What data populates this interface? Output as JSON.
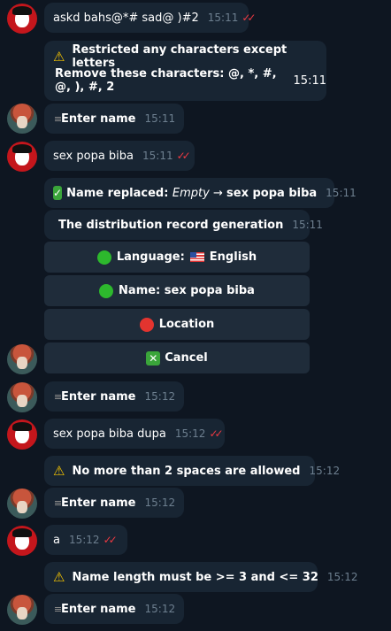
{
  "messages": {
    "m1": {
      "text": "askd bahs@*# sad@ )#2",
      "time": "15:11",
      "ticks": "✓✓"
    },
    "m2": {
      "title": "Restricted any characters except letters",
      "line2": "Remove these characters: @, *, #, @, ), #, 2",
      "time": "15:11"
    },
    "m3": {
      "text": "Enter name",
      "time": "15:11"
    },
    "m4": {
      "text": "sex popa biba",
      "time": "15:11",
      "ticks": "✓✓"
    },
    "m5": {
      "prefix": "Name replaced: ",
      "empty": "Empty",
      "arrow": " → ",
      "value": "sex popa biba",
      "time": "15:11"
    },
    "m6": {
      "text": "The distribution record generation",
      "time": "15:11"
    },
    "m7": {
      "text": "Enter name",
      "time": "15:12"
    },
    "m8": {
      "text": "sex popa biba dupa",
      "time": "15:12",
      "ticks": "✓✓"
    },
    "m9": {
      "text": "No more than 2 spaces are allowed",
      "time": "15:12"
    },
    "m10": {
      "text": "Enter name",
      "time": "15:12"
    },
    "m11": {
      "text": "a",
      "time": "15:12",
      "ticks": "✓✓"
    },
    "m12": {
      "text": "Name length must be >= 3 and <= 32",
      "time": "15:12"
    },
    "m13": {
      "text": "Enter name",
      "time": "15:12"
    }
  },
  "keyboard": {
    "language_label": "Language: ",
    "language_value": "English",
    "name_label": "Name: sex popa biba",
    "location_label": "Location",
    "cancel_label": "Cancel"
  },
  "colors": {
    "background": "#0e1621",
    "bubble": "#182533",
    "button": "#1f2c3a",
    "time": "#6d7f8f",
    "ticks": "#ec3942"
  },
  "icons": {
    "warning": "warning-icon",
    "document": "document-icon",
    "check": "check-mark-icon",
    "disc": "disc-icon",
    "green-circle": "green-circle-icon",
    "red-circle": "red-circle-icon",
    "cross": "cross-mark-icon",
    "flag": "us-flag-icon"
  }
}
